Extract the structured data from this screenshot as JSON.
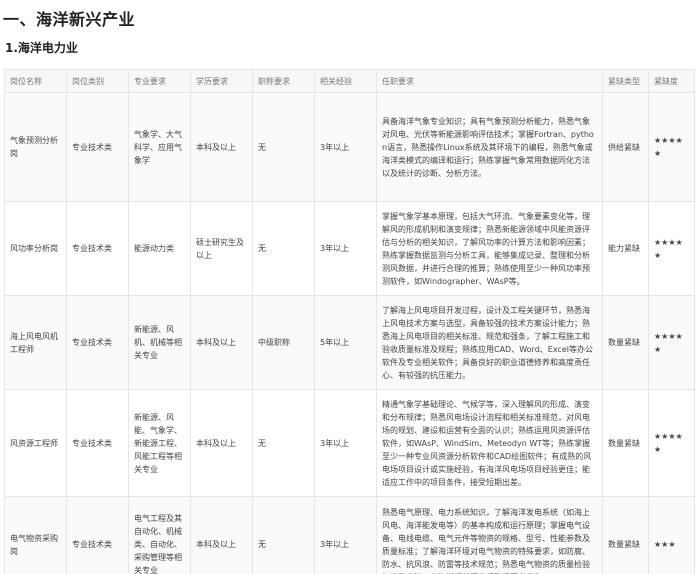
{
  "section_title": "一、海洋新兴产业",
  "subsection_title": "1.海洋电力业",
  "table": {
    "headers": [
      "岗位名称",
      "岗位类别",
      "专业要求",
      "学历要求",
      "职称要求",
      "相关经验",
      "任职要求",
      "紧缺类型",
      "紧缺度"
    ],
    "rows": [
      {
        "name": "气象预测分析岗",
        "category": "专业技术类",
        "major": "气象学、大气科学、应用气象学",
        "education": "本科及以上",
        "title": "无",
        "experience": "3年以上",
        "requirements": "具备海洋气象专业知识；具有气象预测分析能力，熟悉气象对风电、光伏等新能源影响评估技术；掌握Fortran、python语言，熟悉操作Linux系统及其环境下的编程，熟悉气象或海洋类模式的编译和运行；熟练掌握气象常用数据同化方法以及统计的诊断、分析方法。",
        "shortage_type": "供给紧缺",
        "shortage_level": "★★★★★"
      },
      {
        "name": "风功率分析岗",
        "category": "专业技术类",
        "major": "能源动力类",
        "education": "硕士研究生及以上",
        "title": "无",
        "experience": "3年以上",
        "requirements": "掌握气象学基本原理，包括大气环流、气象要素变化等，理解风的形成机制和演变规律；熟悉新能源领域中风能资源评估与分析的相关知识，了解风功率的计算方法和影响因素；熟练掌握数据监测与分析工具，能够集成记录、整理和分析测风数据，并进行合理的推算；熟练使用至少一种风功率预测软件，如Windographer、WAsP等。",
        "shortage_type": "能力紧缺",
        "shortage_level": "★★★★★"
      },
      {
        "name": "海上风电风机工程师",
        "category": "专业技术类",
        "major": "新能源、风机、机械等相关专业",
        "education": "本科及以上",
        "title": "中级职称",
        "experience": "5年以上",
        "requirements": "了解海上风电项目开发过程，设计及工程关键环节，熟悉海上风电技术方案与选型，具备较强的技术方案设计能力；熟悉海上风电项目的相关标准、规范和强条，了解工程施工和验收质量标准及规程；熟练应用CAD、Word、Excel等办公软件及专业相关软件；具备良好的职业道德修养和高度责任心、有较强的抗压能力。",
        "shortage_type": "数量紧缺",
        "shortage_level": "★★★★★"
      },
      {
        "name": "风资源工程师",
        "category": "专业技术类",
        "major": "新能源、风能、气象学、新能源工程、风能工程等相关专业",
        "education": "本科及以上",
        "title": "无",
        "experience": "3年以上",
        "requirements": "精通气象学基础理论、气候学等，深入理解风的形成、演变和分布规律；熟悉风电场设计流程和相关标准规范，对风电场的规划、建设和运营有全面的认识；熟练运用风资源评估软件，如WAsP、WindSim、Meteodyn WT等；熟练掌握至少一种专业风资源分析软件和CAD绘图软件；有成熟的风电场项目设计或实施经验，有海洋风电场项目经验更佳；能适应工作中的项目条件，接受短期出差。",
        "shortage_type": "数量紧缺",
        "shortage_level": "★★★★★"
      },
      {
        "name": "电气物资采购岗",
        "category": "专业技术类",
        "major": "电气工程及其自动化、机械类、自动化、采购管理等相关专业",
        "education": "本科及以上",
        "title": "无",
        "experience": "3年以上",
        "requirements": "熟悉电气原理、电力系统知识，了解海洋发电系统（如海上风电、海洋能发电等）的基本构成和运行原理；掌握电气设备、电线电缆、电气元件等物资的规格、型号、性能参数及质量标准；了解海洋环境对电气物资的特殊要求，如防腐、防水、抗风浪、防雷等技术规范；熟悉电气物资的质量检验标准和方法；有海洋相关行业采购经历者优先。",
        "shortage_type": "数量紧缺",
        "shortage_level": "★★★"
      }
    ]
  }
}
